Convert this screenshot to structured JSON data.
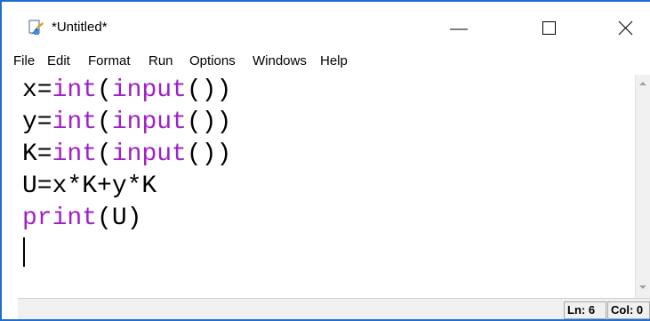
{
  "window": {
    "title": "*Untitled*",
    "icon": "idle-editor-icon"
  },
  "title_controls": {
    "minimize": "minimize-icon",
    "maximize": "maximize-icon",
    "close": "close-icon"
  },
  "menu": [
    "File",
    "Edit",
    "Format",
    "Run",
    "Options",
    "Windows",
    "Help"
  ],
  "editor": {
    "lines": [
      {
        "pre": "x=",
        "kw": "int",
        "mid": "(",
        "kw2": "input",
        "post": "())"
      },
      {
        "pre": "y=",
        "kw": "int",
        "mid": "(",
        "kw2": "input",
        "post": "())"
      },
      {
        "pre": "K=",
        "kw": "int",
        "mid": "(",
        "kw2": "input",
        "post": "())"
      },
      {
        "pre": "U=x*K+y*K",
        "kw": "",
        "mid": "",
        "kw2": "",
        "post": ""
      },
      {
        "pre": "",
        "kw": "print",
        "mid": "(U)",
        "kw2": "",
        "post": ""
      }
    ],
    "keyword_color": "#a020c8"
  },
  "status": {
    "line": "Ln: 6",
    "col": "Col: 0"
  },
  "colors": {
    "window_border": "#1e6fd0",
    "statusbar_bg": "#f0f0f0"
  }
}
